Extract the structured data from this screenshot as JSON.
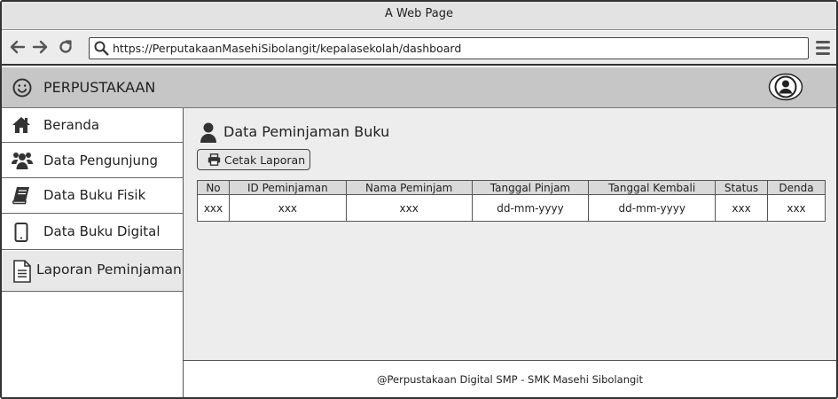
{
  "window": {
    "title": "A Web Page"
  },
  "browser": {
    "url": "https://PerputakaanMasehiSibolangit/kepalasekolah/dashboard",
    "icons": {
      "back": "arrow-left-icon",
      "forward": "arrow-right-icon",
      "reload": "reload-icon",
      "search": "search-icon",
      "menu": "hamburger-menu-icon"
    }
  },
  "header": {
    "brand": "PERPUSTAKAAN",
    "logo_icon": "smiley-icon",
    "avatar_icon": "user-avatar-icon"
  },
  "sidebar": {
    "items": [
      {
        "label": "Beranda",
        "icon": "home-icon"
      },
      {
        "label": "Data Pengunjung",
        "icon": "users-icon"
      },
      {
        "label": "Data Buku Fisik",
        "icon": "book-icon"
      },
      {
        "label": "Data Buku Digital",
        "icon": "tablet-icon"
      },
      {
        "label": "Laporan Peminjaman",
        "icon": "document-icon",
        "active": true
      }
    ]
  },
  "main": {
    "title": "Data Peminjaman Buku",
    "title_icon": "user-icon",
    "print_button": {
      "label": "Cetak Laporan",
      "icon": "printer-icon"
    },
    "table": {
      "columns": [
        "No",
        "ID Peminjaman",
        "Nama Peminjam",
        "Tanggal Pinjam",
        "Tanggal Kembali",
        "Status",
        "Denda"
      ],
      "rows": [
        [
          "xxx",
          "xxx",
          "xxx",
          "dd-mm-yyyy",
          "dd-mm-yyyy",
          "xxx",
          "xxx"
        ]
      ]
    }
  },
  "footer": {
    "text": "@Perpustakaan Digital SMP - SMK Masehi Sibolangit"
  }
}
